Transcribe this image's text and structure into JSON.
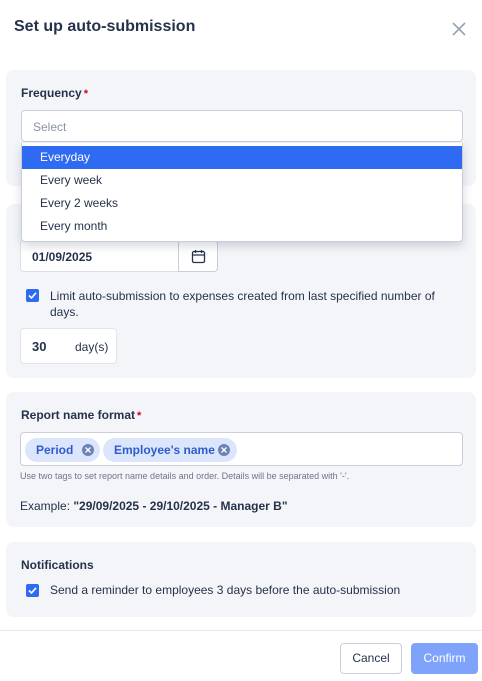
{
  "modal": {
    "title": "Set up auto-submission",
    "close_icon": "close-icon"
  },
  "frequency": {
    "label": "Frequency",
    "required_mark": "*",
    "placeholder": "Select",
    "options": [
      "Everyday",
      "Every week",
      "Every 2 weeks",
      "Every month"
    ],
    "highlighted_option": "Everyday"
  },
  "start_date": {
    "value": "01/09/2025",
    "icon": "calendar-icon"
  },
  "limit": {
    "checked": true,
    "text": "Limit auto-submission to expenses created from last specified number of days.",
    "days_value": "30",
    "days_unit": "day(s)"
  },
  "report_name": {
    "label": "Report name format",
    "required_mark": "*",
    "tags": [
      "Period",
      "Employee's name"
    ],
    "hint": "Use two tags to set report name details and order. Details will be separated with '-'.",
    "example_prefix": "Example: ",
    "example_value": "\"29/09/2025 - 29/10/2025 - Manager B\""
  },
  "notifications": {
    "label": "Notifications",
    "checked": true,
    "text": "Send a reminder to employees 3 days before the auto-submission"
  },
  "footer": {
    "cancel_label": "Cancel",
    "confirm_label": "Confirm"
  },
  "colors": {
    "accent": "#2f6bf2",
    "confirm_disabled": "#7fa3fb",
    "required": "#d0021b",
    "card_bg": "#f3f5f9"
  }
}
